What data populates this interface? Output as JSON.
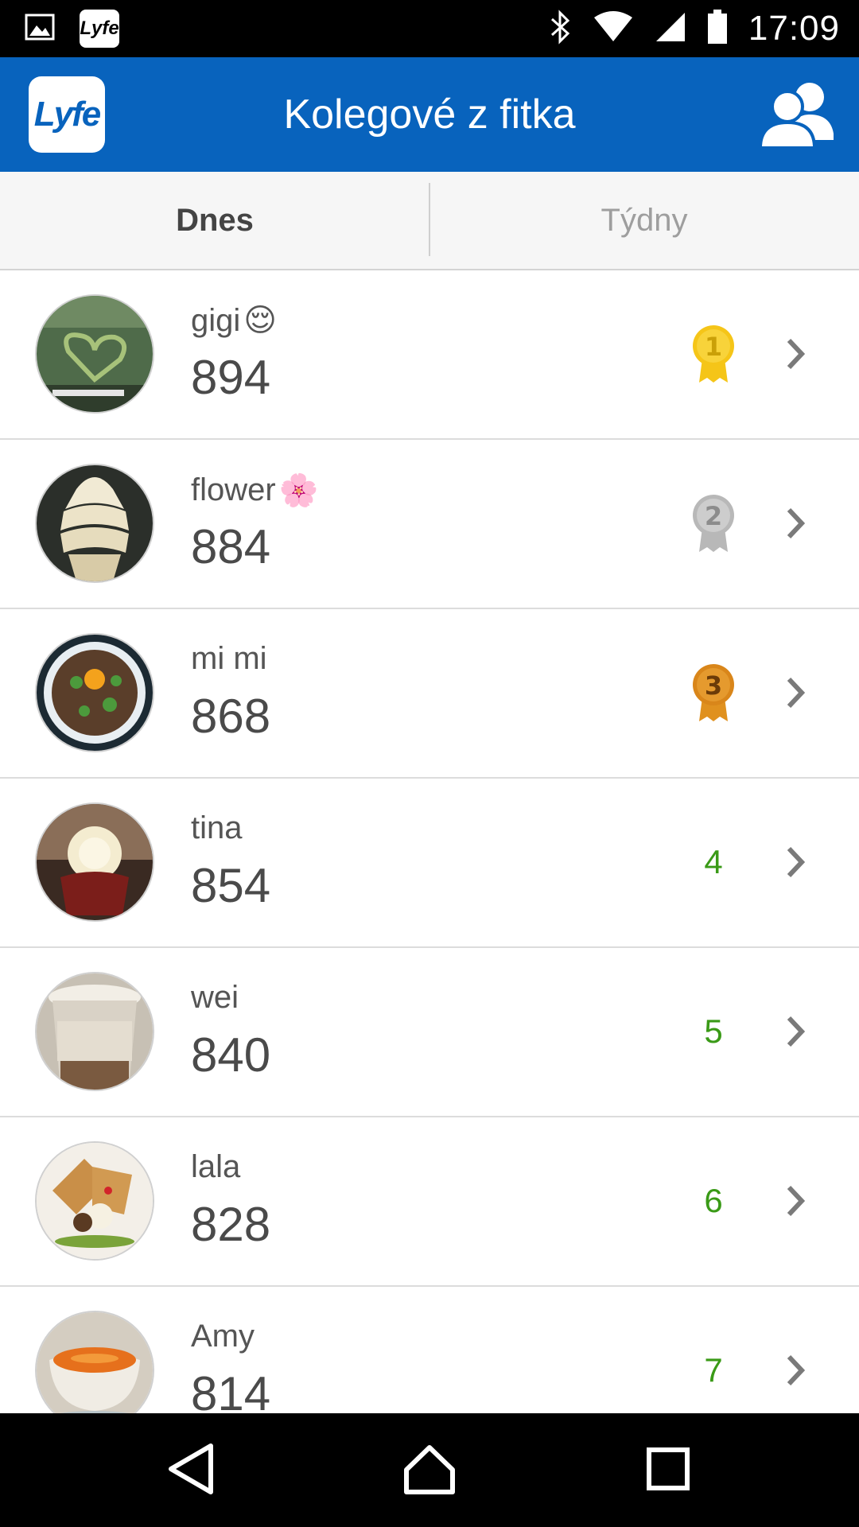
{
  "status_bar": {
    "time": "17:09",
    "left_icons": [
      "image-notification-icon",
      "lyfe-notification-icon"
    ],
    "left_app_badge": "Lyfe",
    "right_icons": [
      "bluetooth-icon",
      "wifi-icon",
      "signal-icon",
      "battery-icon"
    ]
  },
  "app_bar": {
    "logo_text": "Lyfe",
    "title": "Kolegové z fitka",
    "friends_icon": "friends-icon"
  },
  "tabs": [
    {
      "label": "Dnes",
      "active": true
    },
    {
      "label": "Týdny",
      "active": false
    }
  ],
  "leaderboard": [
    {
      "name": "gigi",
      "emoji": "😌",
      "score": "894",
      "rank": "1",
      "medal": "gold",
      "avatar": "heart-shaped-field"
    },
    {
      "name": "flower",
      "emoji": "🌸",
      "score": "884",
      "rank": "2",
      "medal": "silver",
      "avatar": "soft-serve-ice-cream"
    },
    {
      "name": "mi mi",
      "emoji": "",
      "score": "868",
      "rank": "3",
      "medal": "bronze",
      "avatar": "rice-bowl-with-egg"
    },
    {
      "name": "tina",
      "emoji": "",
      "score": "854",
      "rank": "4",
      "medal": "",
      "avatar": "rose-cupcake"
    },
    {
      "name": "wei",
      "emoji": "",
      "score": "840",
      "rank": "5",
      "medal": "",
      "avatar": "iced-coffee-cup"
    },
    {
      "name": "lala",
      "emoji": "",
      "score": "828",
      "rank": "6",
      "medal": "",
      "avatar": "waffle-dessert-plate"
    },
    {
      "name": "Amy",
      "emoji": "",
      "score": "814",
      "rank": "7",
      "medal": "",
      "avatar": "soup-bowl"
    }
  ],
  "colors": {
    "brand_blue": "#0863bd",
    "gold": "#f5c518",
    "silver": "#b8b8b8",
    "bronze": "#d9861a",
    "rank_green": "#3a9a17"
  },
  "nav_bar": {
    "buttons": [
      "back-icon",
      "home-icon",
      "recents-icon"
    ]
  }
}
